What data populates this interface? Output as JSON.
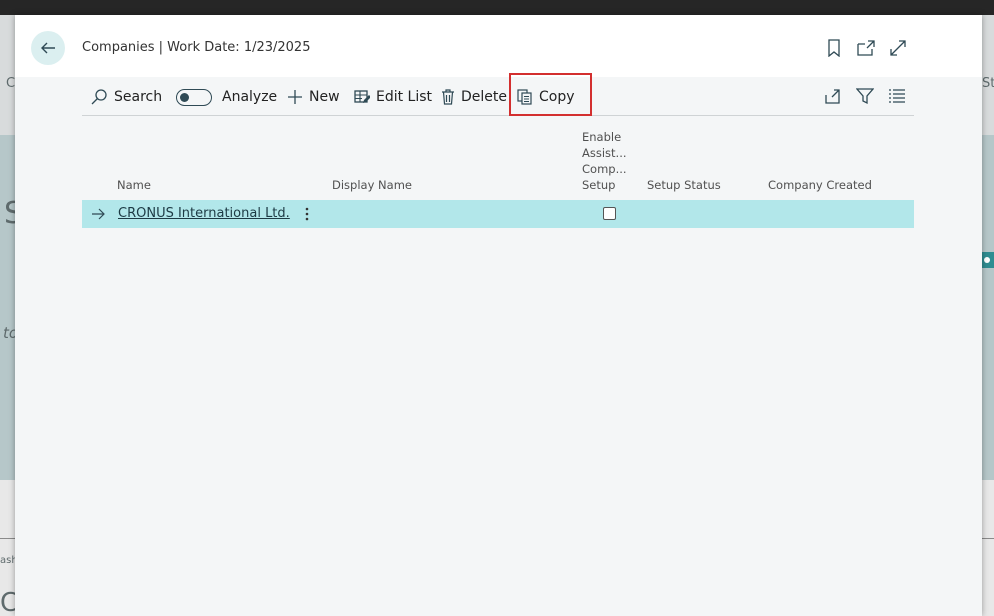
{
  "background": {
    "fragments": {
      "left_c": "C",
      "left_s": "S",
      "left_to": "to",
      "left_ash": "ash",
      "left_bottom": "C",
      "right_st": "St"
    }
  },
  "dialog": {
    "title": "Companies | Work Date: 1/23/2025",
    "header_icons": [
      "bookmark-icon",
      "open-in-new-window-icon",
      "expand-icon"
    ]
  },
  "actions": {
    "search": "Search",
    "analyze": "Analyze",
    "analyze_toggle_on": false,
    "new": "New",
    "edit_list": "Edit List",
    "delete": "Delete",
    "copy": "Copy",
    "right_icons": [
      "share-icon",
      "filter-icon",
      "list-view-icon"
    ]
  },
  "table": {
    "columns": {
      "name": "Name",
      "display_name": "Display Name",
      "enable_assisted_1": "Enable",
      "enable_assisted_2": "Assist...",
      "enable_assisted_3": "Comp...",
      "enable_assisted_4": "Setup",
      "setup_status": "Setup Status",
      "company_created": "Company Created"
    },
    "rows": [
      {
        "name": "CRONUS International Ltd.",
        "display_name": "",
        "enable_assisted_setup": false,
        "setup_status": "",
        "company_created": ""
      }
    ]
  },
  "colors": {
    "accent": "#b2e7ea",
    "highlight_border": "#d32f2f",
    "icon": "#2f4a55"
  }
}
